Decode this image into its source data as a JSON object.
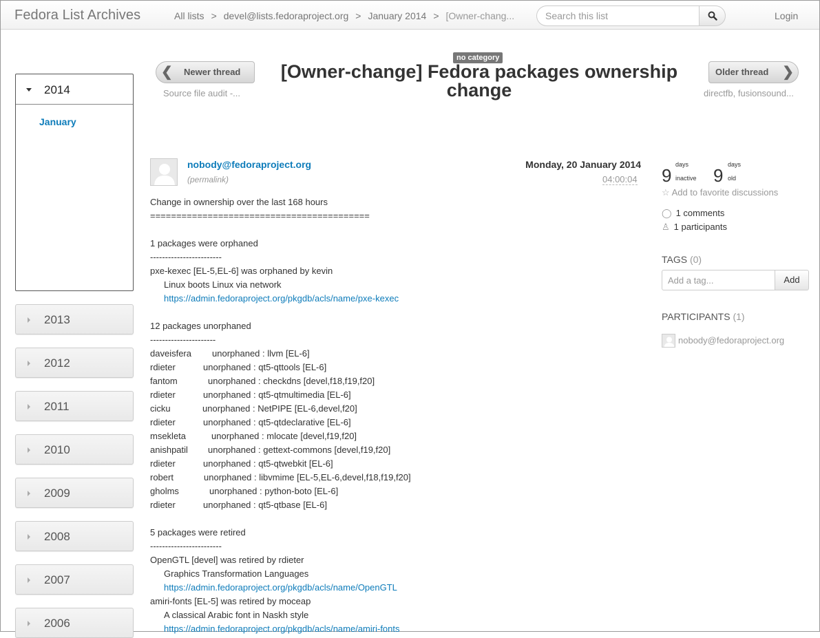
{
  "navbar": {
    "brand": "Fedora List Archives",
    "breadcrumbs": [
      "All lists",
      "devel@lists.fedoraproject.org",
      "January 2014",
      "[Owner-chang..."
    ],
    "search_placeholder": "Search this list",
    "login": "Login"
  },
  "sidebar": {
    "open_year": "2014",
    "months": [
      "January"
    ],
    "closed_years": [
      "2013",
      "2012",
      "2011",
      "2010",
      "2009",
      "2008",
      "2007",
      "2006"
    ]
  },
  "thread": {
    "category": "no category",
    "title": "[Owner-change] Fedora packages ownership change",
    "newer_label": "Newer thread",
    "newer_subject": "Source file audit -...",
    "older_label": "Older thread",
    "older_subject": "directfb, fusionsound..."
  },
  "message": {
    "sender": "nobody@fedoraproject.org",
    "permalink": "(permalink)",
    "date": "Monday, 20 January 2014",
    "time": "04:00:04",
    "lines": [
      {
        "text": "Change in ownership over the last 168 hours"
      },
      {
        "text": "=========================================="
      },
      {
        "text": ""
      },
      {
        "text": "1 packages were orphaned"
      },
      {
        "text": "------------------------"
      },
      {
        "text": "pxe-kexec [EL-5,EL-6] was orphaned by kevin"
      },
      {
        "text": "Linux boots Linux via network",
        "indent": true
      },
      {
        "text": "https://admin.fedoraproject.org/pkgdb/acls/name/pxe-kexec",
        "indent": true,
        "link": true
      },
      {
        "text": ""
      },
      {
        "text": "12 packages unorphaned"
      },
      {
        "text": "----------------------"
      },
      {
        "user": "daveisfera",
        "action": "unorphaned : llvm [EL-6]"
      },
      {
        "user": "rdieter",
        "action": "unorphaned : qt5-qttools [EL-6]"
      },
      {
        "user": "fantom",
        "action": "unorphaned : checkdns [devel,f18,f19,f20]"
      },
      {
        "user": "rdieter",
        "action": "unorphaned : qt5-qtmultimedia [EL-6]"
      },
      {
        "user": "cicku",
        "action": "unorphaned : NetPIPE [EL-6,devel,f20]"
      },
      {
        "user": "rdieter",
        "action": "unorphaned : qt5-qtdeclarative [EL-6]"
      },
      {
        "user": "msekleta",
        "action": "unorphaned : mlocate [devel,f19,f20]"
      },
      {
        "user": "anishpatil",
        "action": "unorphaned : gettext-commons [devel,f19,f20]"
      },
      {
        "user": "rdieter",
        "action": "unorphaned : qt5-qtwebkit [EL-6]"
      },
      {
        "user": "robert",
        "action": "unorphaned : libvmime [EL-5,EL-6,devel,f18,f19,f20]"
      },
      {
        "user": "gholms",
        "action": "unorphaned : python-boto [EL-6]"
      },
      {
        "user": "rdieter",
        "action": "unorphaned : qt5-qtbase [EL-6]"
      },
      {
        "text": ""
      },
      {
        "text": "5 packages were retired"
      },
      {
        "text": "------------------------"
      },
      {
        "text": "OpenGTL [devel] was retired by rdieter"
      },
      {
        "text": "Graphics Transformation Languages",
        "indent": true
      },
      {
        "text": "https://admin.fedoraproject.org/pkgdb/acls/name/OpenGTL",
        "indent": true,
        "link": true
      },
      {
        "text": "amiri-fonts [EL-5] was retired by moceap"
      },
      {
        "text": "A classical Arabic font in Naskh style",
        "indent": true
      },
      {
        "text": "https://admin.fedoraproject.org/pkgdb/acls/name/amiri-fonts",
        "indent": true,
        "link": true
      }
    ]
  },
  "stats": {
    "inactive_num": "9",
    "inactive_top": "days",
    "inactive_bottom": "inactive",
    "old_num": "9",
    "old_top": "days",
    "old_bottom": "old",
    "favorite": "Add to favorite discussions",
    "comments": "1 comments",
    "participants": "1 participants"
  },
  "tags": {
    "title": "TAGS",
    "count": "(0)",
    "placeholder": "Add a tag...",
    "add": "Add"
  },
  "participants": {
    "title": "PARTICIPANTS",
    "count": "(1)",
    "names": [
      "nobody@fedoraproject.org"
    ]
  },
  "colors": {
    "link": "#0e7cba",
    "badge": "#777777"
  }
}
